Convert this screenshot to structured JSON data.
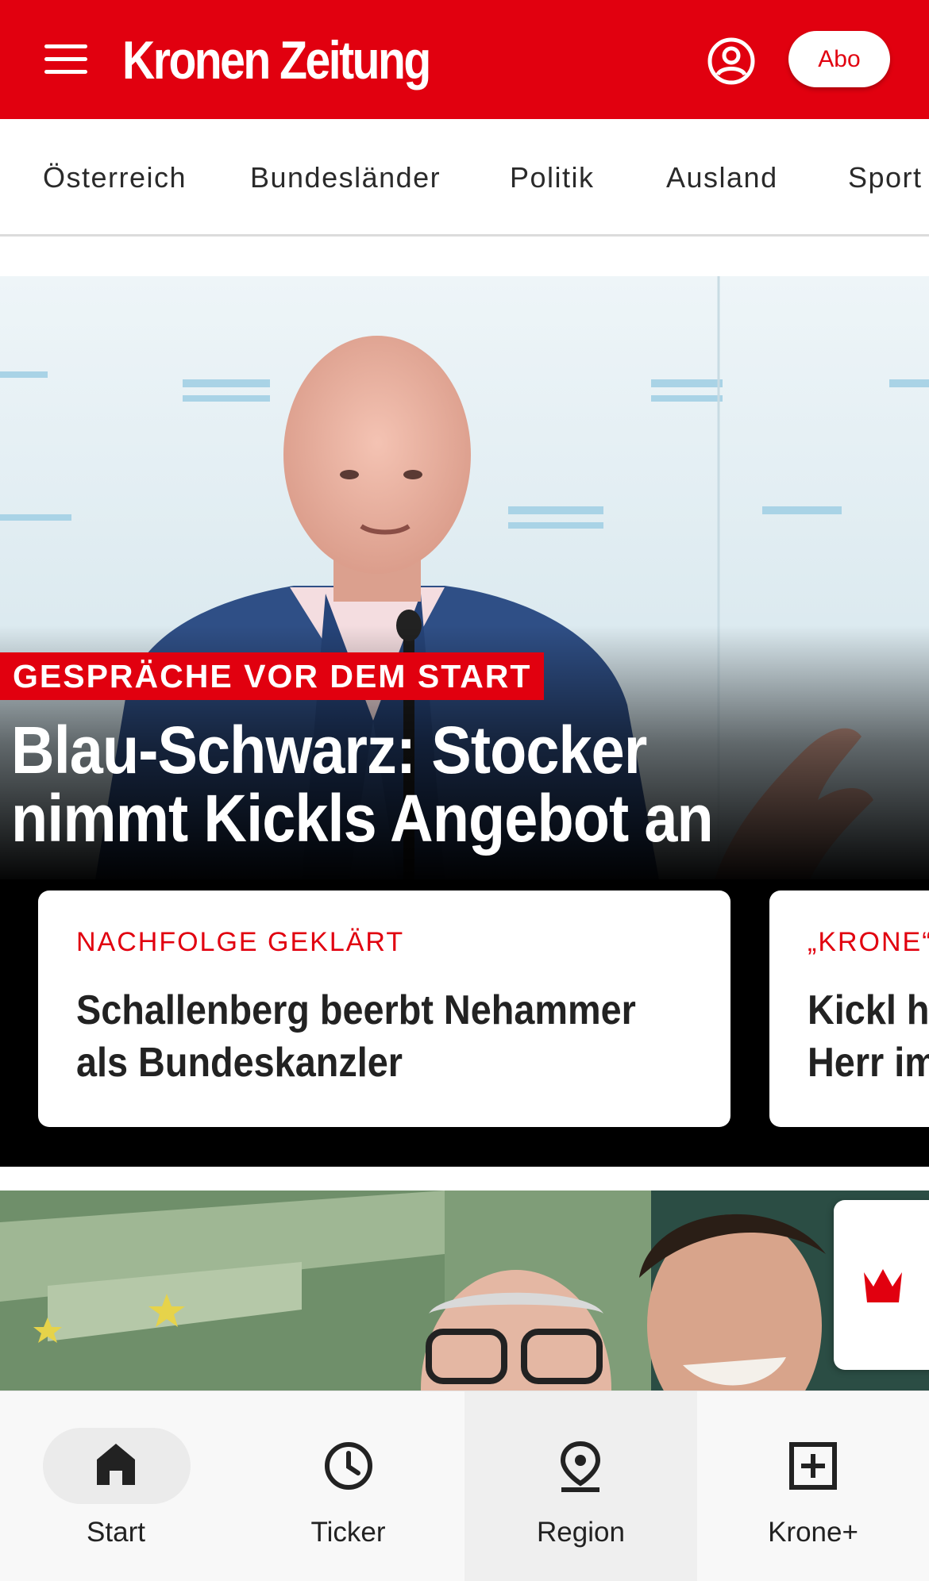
{
  "header": {
    "logo_text": "Kronen Zeitung",
    "menu_icon": "hamburger-menu-icon",
    "account_icon": "user-account-icon",
    "abo_label": "Abo",
    "brand_color": "#e1000f"
  },
  "categories": [
    {
      "label": "Österreich"
    },
    {
      "label": "Bundesländer"
    },
    {
      "label": "Politik"
    },
    {
      "label": "Ausland"
    },
    {
      "label": "Sport"
    }
  ],
  "hero": {
    "kicker": "GESPRÄCHE VOR DEM START",
    "title": "Blau-Schwarz: Stocker nimmt Kickls Angebot an",
    "cards": [
      {
        "kicker": "NACHFOLGE GEKLÄRT",
        "title_line1": "Schallenberg beerbt Nehammer",
        "title_line2": "als Bundeskanzler"
      },
      {
        "kicker": "„KRONE“",
        "title_line1": "Kickl h",
        "title_line2": "Herr im"
      }
    ]
  },
  "krone_plus_badge_icon": "krone-crown-icon",
  "bottom_nav": {
    "items": [
      {
        "label": "Start",
        "icon": "home-icon",
        "active": true
      },
      {
        "label": "Ticker",
        "icon": "clock-icon"
      },
      {
        "label": "Region",
        "icon": "location-pin-icon"
      },
      {
        "label": "Krone+",
        "icon": "plus-box-icon"
      }
    ]
  }
}
